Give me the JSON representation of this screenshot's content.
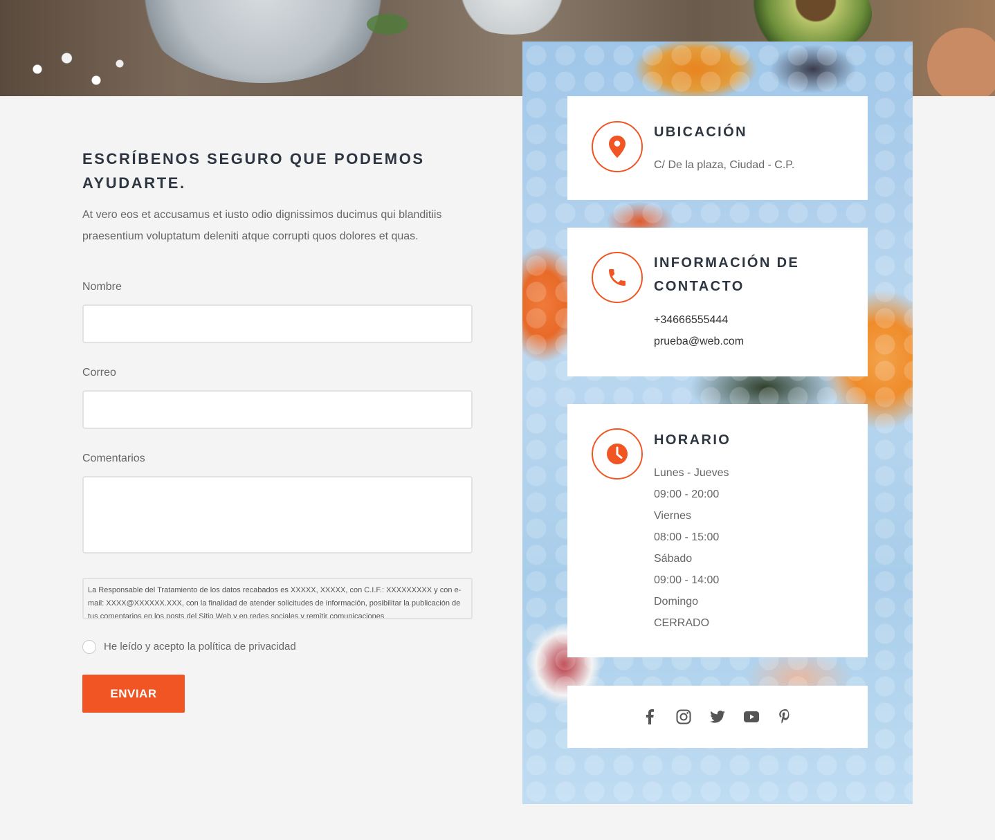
{
  "form": {
    "title": "ESCRÍBENOS SEGURO QUE PODEMOS AYUDARTE.",
    "intro": "At vero eos et accusamus et iusto odio dignissimos ducimus qui blanditiis praesentium voluptatum deleniti atque corrupti quos dolores et quas.",
    "name_label": "Nombre",
    "email_label": "Correo",
    "comments_label": "Comentarios",
    "policy_text": "La Responsable del Tratamiento de los datos recabados es XXXXX, XXXXX, con C.I.F.: XXXXXXXXX y con e-mail: XXXX@XXXXXX.XXX, con la finalidad de atender solicitudes de información, posibilitar la publicación de tus comentarios en los posts del Sitio Web y en redes sociales y remitir comunicaciones",
    "privacy_label": "He leído y acepto la política de privacidad",
    "submit_label": "ENVIAR"
  },
  "location": {
    "title": "UBICACIÓN",
    "address": "C/ De la plaza, Ciudad - C.P."
  },
  "contact": {
    "title": "INFORMACIÓN DE CONTACTO",
    "phone": "+34666555444",
    "email": "prueba@web.com"
  },
  "schedule": {
    "title": "HORARIO",
    "lines": [
      "Lunes - Jueves",
      "09:00 - 20:00",
      "Viernes",
      "08:00 - 15:00",
      "Sábado",
      "09:00 - 14:00",
      "Domingo",
      "CERRADO"
    ]
  },
  "social": {
    "icons": [
      "facebook-icon",
      "instagram-icon",
      "twitter-icon",
      "youtube-icon",
      "pinterest-icon"
    ]
  },
  "colors": {
    "accent": "#f05523",
    "heading": "#2d3540",
    "background": "#f4f4f4"
  }
}
